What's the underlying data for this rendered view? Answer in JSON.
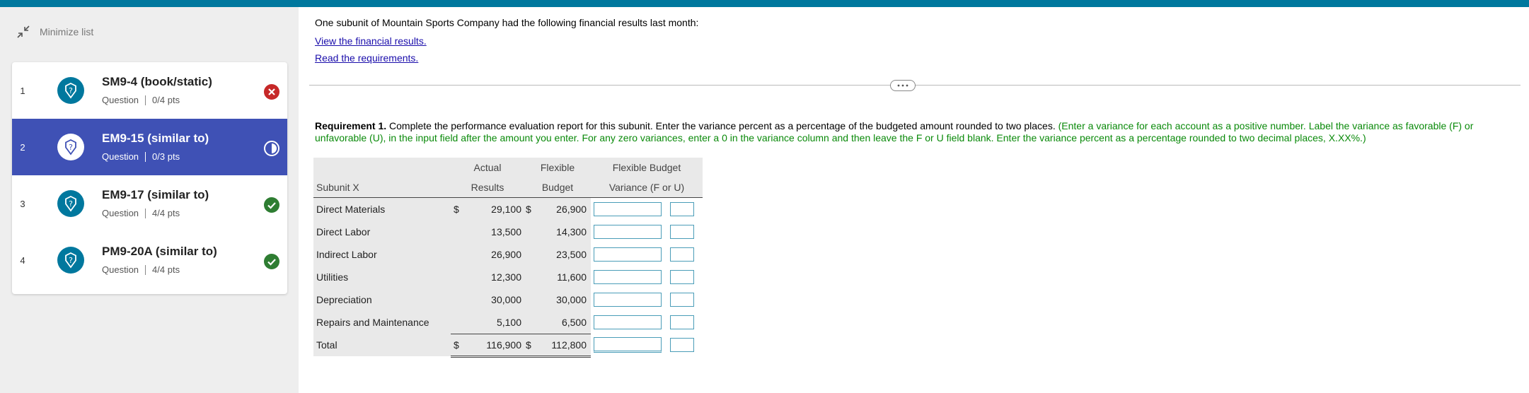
{
  "sidebar": {
    "minimize_label": "Minimize list",
    "items": [
      {
        "number": "1",
        "title": "SM9-4 (book/static)",
        "type": "Question",
        "points": "0/4 pts",
        "status": "incorrect",
        "active": false
      },
      {
        "number": "2",
        "title": "EM9-15 (similar to)",
        "type": "Question",
        "points": "0/3 pts",
        "status": "partial",
        "active": true
      },
      {
        "number": "3",
        "title": "EM9-17 (similar to)",
        "type": "Question",
        "points": "4/4 pts",
        "status": "correct",
        "active": false
      },
      {
        "number": "4",
        "title": "PM9-20A (similar to)",
        "type": "Question",
        "points": "4/4 pts",
        "status": "correct",
        "active": false
      }
    ]
  },
  "main": {
    "intro": "One subunit of Mountain Sports Company had the following financial results last month:",
    "link_results": "View the financial results.",
    "link_requirements": "Read the requirements.",
    "requirement_label": "Requirement 1.",
    "requirement_text": " Complete the performance evaluation report for this subunit. Enter the variance percent as a percentage of the budgeted amount rounded to two places. ",
    "requirement_hint": "(Enter a variance for each account as a positive number. Label the variance as favorable (F) or unfavorable (U), in the input field after the amount you enter. For any zero variances, enter a 0 in the variance column and then leave the F or U field blank. Enter the variance percent as a percentage rounded to two decimal places, X.XX%.)"
  },
  "table": {
    "header_row1": {
      "actual": "Actual",
      "flexible": "Flexible",
      "variance": "Flexible Budget"
    },
    "header_row2": {
      "label": "Subunit X",
      "actual": "Results",
      "flexible": "Budget",
      "variance": "Variance (F or U)"
    },
    "rows": [
      {
        "label": "Direct Materials",
        "actual_dollar": "$",
        "actual": "29,100",
        "budget_dollar": "$",
        "budget": "26,900"
      },
      {
        "label": "Direct Labor",
        "actual_dollar": "",
        "actual": "13,500",
        "budget_dollar": "",
        "budget": "14,300"
      },
      {
        "label": "Indirect Labor",
        "actual_dollar": "",
        "actual": "26,900",
        "budget_dollar": "",
        "budget": "23,500"
      },
      {
        "label": "Utilities",
        "actual_dollar": "",
        "actual": "12,300",
        "budget_dollar": "",
        "budget": "11,600"
      },
      {
        "label": "Depreciation",
        "actual_dollar": "",
        "actual": "30,000",
        "budget_dollar": "",
        "budget": "30,000"
      },
      {
        "label": "Repairs and Maintenance",
        "actual_dollar": "",
        "actual": "5,100",
        "budget_dollar": "",
        "budget": "6,500"
      }
    ],
    "total": {
      "label": "Total",
      "actual_dollar": "$",
      "actual": "116,900",
      "budget_dollar": "$",
      "budget": "112,800"
    }
  },
  "colors": {
    "accent": "#00789e",
    "active_item": "#3f51b5",
    "incorrect": "#c62828",
    "correct": "#2e7d32",
    "hint": "#0a8a0a"
  }
}
